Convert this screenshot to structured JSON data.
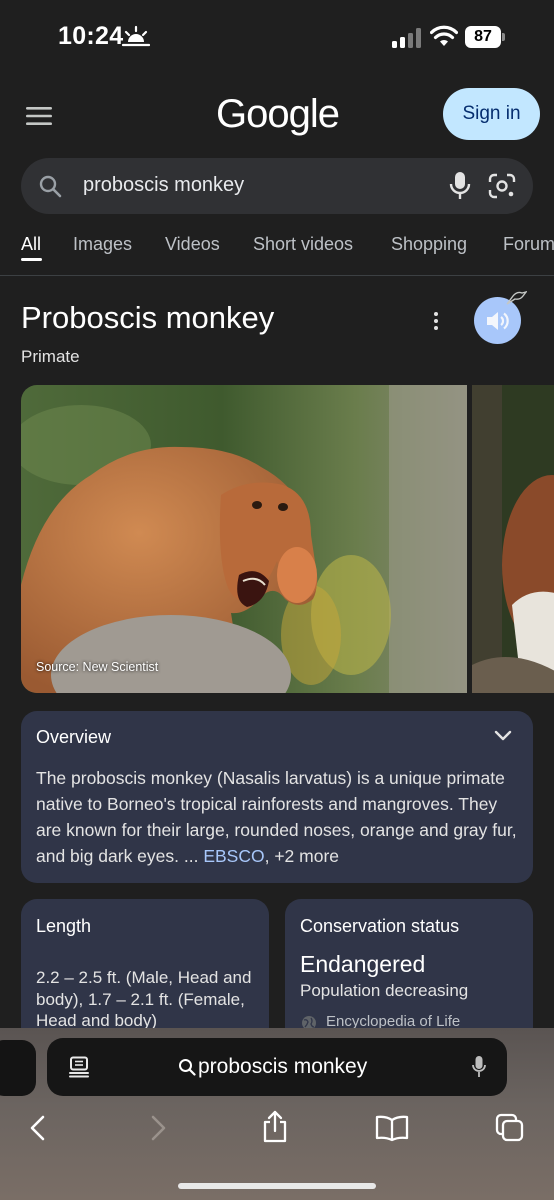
{
  "status_bar": {
    "time": "10:24",
    "battery": "87"
  },
  "header": {
    "logo_text": "Google",
    "sign_in_label": "Sign in"
  },
  "search": {
    "query": "proboscis monkey"
  },
  "tabs": [
    {
      "label": "All",
      "active": true
    },
    {
      "label": "Images"
    },
    {
      "label": "Videos"
    },
    {
      "label": "Short videos"
    },
    {
      "label": "Shopping"
    },
    {
      "label": "Forums"
    }
  ],
  "knowledge_panel": {
    "title": "Proboscis monkey",
    "subtitle": "Primate",
    "image_source": "Source: New Scientist",
    "overview": {
      "title": "Overview",
      "text": "The proboscis monkey (Nasalis larvatus) is a unique primate native to Borneo's tropical rainforests and mangroves. They are known for their large, rounded noses, orange and gray fur, and big dark eyes. ... ",
      "source_link": "EBSCO",
      "more": ", +2 more"
    },
    "length_card": {
      "title": "Length",
      "body": "2.2 – 2.5 ft. (Male, Head and body), 1.7 – 2.1 ft. (Female, Head and body)"
    },
    "conservation_card": {
      "title": "Conservation status",
      "status": "Endangered",
      "trend": "Population decreasing",
      "source": "Encyclopedia of Life"
    }
  },
  "safari": {
    "address_text": "proboscis monkey"
  },
  "colors": {
    "background": "#1f1f1f",
    "card": "#303548",
    "accent": "#a8c7fa",
    "signin_bg": "#c2e7ff"
  }
}
